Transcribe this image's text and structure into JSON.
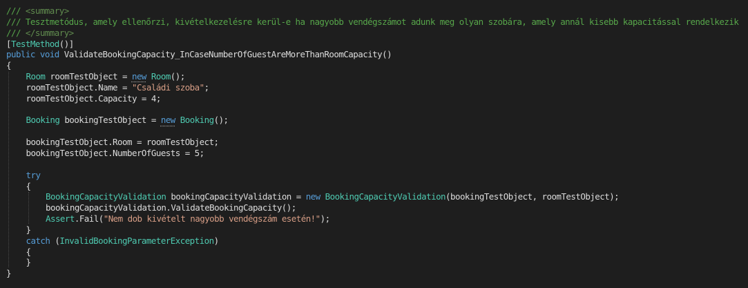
{
  "theme": {
    "background": "#1e1e1e",
    "default_text": "#dcdcdc",
    "comment": "#57a64a",
    "xml_doc_tag": "#608b4e",
    "keyword": "#569cd6",
    "type": "#4ec9b0",
    "string": "#d69d85",
    "indent_guide": "#4a4a4a"
  },
  "code": {
    "lines": [
      {
        "indent": 0,
        "tokens": [
          {
            "t": "/// ",
            "c": "comment"
          },
          {
            "t": "<summary>",
            "c": "xml_doc_tag"
          }
        ]
      },
      {
        "indent": 0,
        "tokens": [
          {
            "t": "/// Tesztmetódus, amely ellenőrzi, kivételkezelésre kerül-e ha nagyobb vendégszámot adunk meg olyan szobára, amely annál kisebb kapacitással rendelkezik",
            "c": "comment"
          }
        ]
      },
      {
        "indent": 0,
        "tokens": [
          {
            "t": "/// ",
            "c": "comment"
          },
          {
            "t": "</summary>",
            "c": "xml_doc_tag"
          }
        ]
      },
      {
        "indent": 0,
        "tokens": [
          {
            "t": "[",
            "c": "default_text"
          },
          {
            "t": "TestMethod",
            "c": "type"
          },
          {
            "t": "()]",
            "c": "default_text"
          }
        ]
      },
      {
        "indent": 0,
        "tokens": [
          {
            "t": "public",
            "c": "keyword"
          },
          {
            "t": " ",
            "c": "default_text"
          },
          {
            "t": "void",
            "c": "keyword"
          },
          {
            "t": " ValidateBookingCapacity_InCaseNumberOfGuestAreMoreThanRoomCapacity()",
            "c": "default_text"
          }
        ]
      },
      {
        "indent": 0,
        "tokens": [
          {
            "t": "{",
            "c": "default_text"
          }
        ]
      },
      {
        "indent": 1,
        "tokens": [
          {
            "t": "Room",
            "c": "type"
          },
          {
            "t": " roomTestObject = ",
            "c": "default_text"
          },
          {
            "t": "new",
            "c": "keyword",
            "squiggle": true
          },
          {
            "t": " ",
            "c": "default_text"
          },
          {
            "t": "Room",
            "c": "type"
          },
          {
            "t": "();",
            "c": "default_text"
          }
        ]
      },
      {
        "indent": 1,
        "tokens": [
          {
            "t": "roomTestObject.Name = ",
            "c": "default_text"
          },
          {
            "t": "\"Családi szoba\"",
            "c": "string"
          },
          {
            "t": ";",
            "c": "default_text"
          }
        ]
      },
      {
        "indent": 1,
        "tokens": [
          {
            "t": "roomTestObject.Capacity = 4;",
            "c": "default_text"
          }
        ]
      },
      {
        "indent": 1,
        "tokens": []
      },
      {
        "indent": 1,
        "tokens": [
          {
            "t": "Booking",
            "c": "type"
          },
          {
            "t": " bookingTestObject = ",
            "c": "default_text"
          },
          {
            "t": "new",
            "c": "keyword",
            "squiggle": true
          },
          {
            "t": " ",
            "c": "default_text"
          },
          {
            "t": "Booking",
            "c": "type"
          },
          {
            "t": "();",
            "c": "default_text"
          }
        ]
      },
      {
        "indent": 1,
        "tokens": []
      },
      {
        "indent": 1,
        "tokens": [
          {
            "t": "bookingTestObject.Room = roomTestObject;",
            "c": "default_text"
          }
        ]
      },
      {
        "indent": 1,
        "tokens": [
          {
            "t": "bookingTestObject.NumberOfGuests = 5;",
            "c": "default_text"
          }
        ]
      },
      {
        "indent": 1,
        "tokens": []
      },
      {
        "indent": 1,
        "tokens": [
          {
            "t": "try",
            "c": "keyword"
          }
        ]
      },
      {
        "indent": 1,
        "tokens": [
          {
            "t": "{",
            "c": "default_text"
          }
        ]
      },
      {
        "indent": 2,
        "tokens": [
          {
            "t": "BookingCapacityValidation",
            "c": "type"
          },
          {
            "t": " bookingCapacityValidation = ",
            "c": "default_text"
          },
          {
            "t": "new",
            "c": "keyword"
          },
          {
            "t": " ",
            "c": "default_text"
          },
          {
            "t": "BookingCapacityValidation",
            "c": "type"
          },
          {
            "t": "(bookingTestObject, roomTestObject);",
            "c": "default_text"
          }
        ]
      },
      {
        "indent": 2,
        "tokens": [
          {
            "t": "bookingCapacityValidation.ValidateBookingCapacity();",
            "c": "default_text"
          }
        ]
      },
      {
        "indent": 2,
        "tokens": [
          {
            "t": "Assert",
            "c": "type"
          },
          {
            "t": ".Fail(",
            "c": "default_text"
          },
          {
            "t": "\"Nem dob kivételt nagyobb vendégszám esetén!\"",
            "c": "string"
          },
          {
            "t": ");",
            "c": "default_text"
          }
        ]
      },
      {
        "indent": 1,
        "tokens": [
          {
            "t": "}",
            "c": "default_text"
          }
        ]
      },
      {
        "indent": 1,
        "tokens": [
          {
            "t": "catch",
            "c": "keyword"
          },
          {
            "t": " (",
            "c": "default_text"
          },
          {
            "t": "InvalidBookingParameterException",
            "c": "type"
          },
          {
            "t": ")",
            "c": "default_text"
          }
        ]
      },
      {
        "indent": 1,
        "tokens": [
          {
            "t": "{",
            "c": "default_text"
          }
        ]
      },
      {
        "indent": 1,
        "tokens": [
          {
            "t": "}",
            "c": "default_text"
          }
        ]
      },
      {
        "indent": 0,
        "tokens": [
          {
            "t": "}",
            "c": "default_text"
          }
        ]
      }
    ]
  }
}
